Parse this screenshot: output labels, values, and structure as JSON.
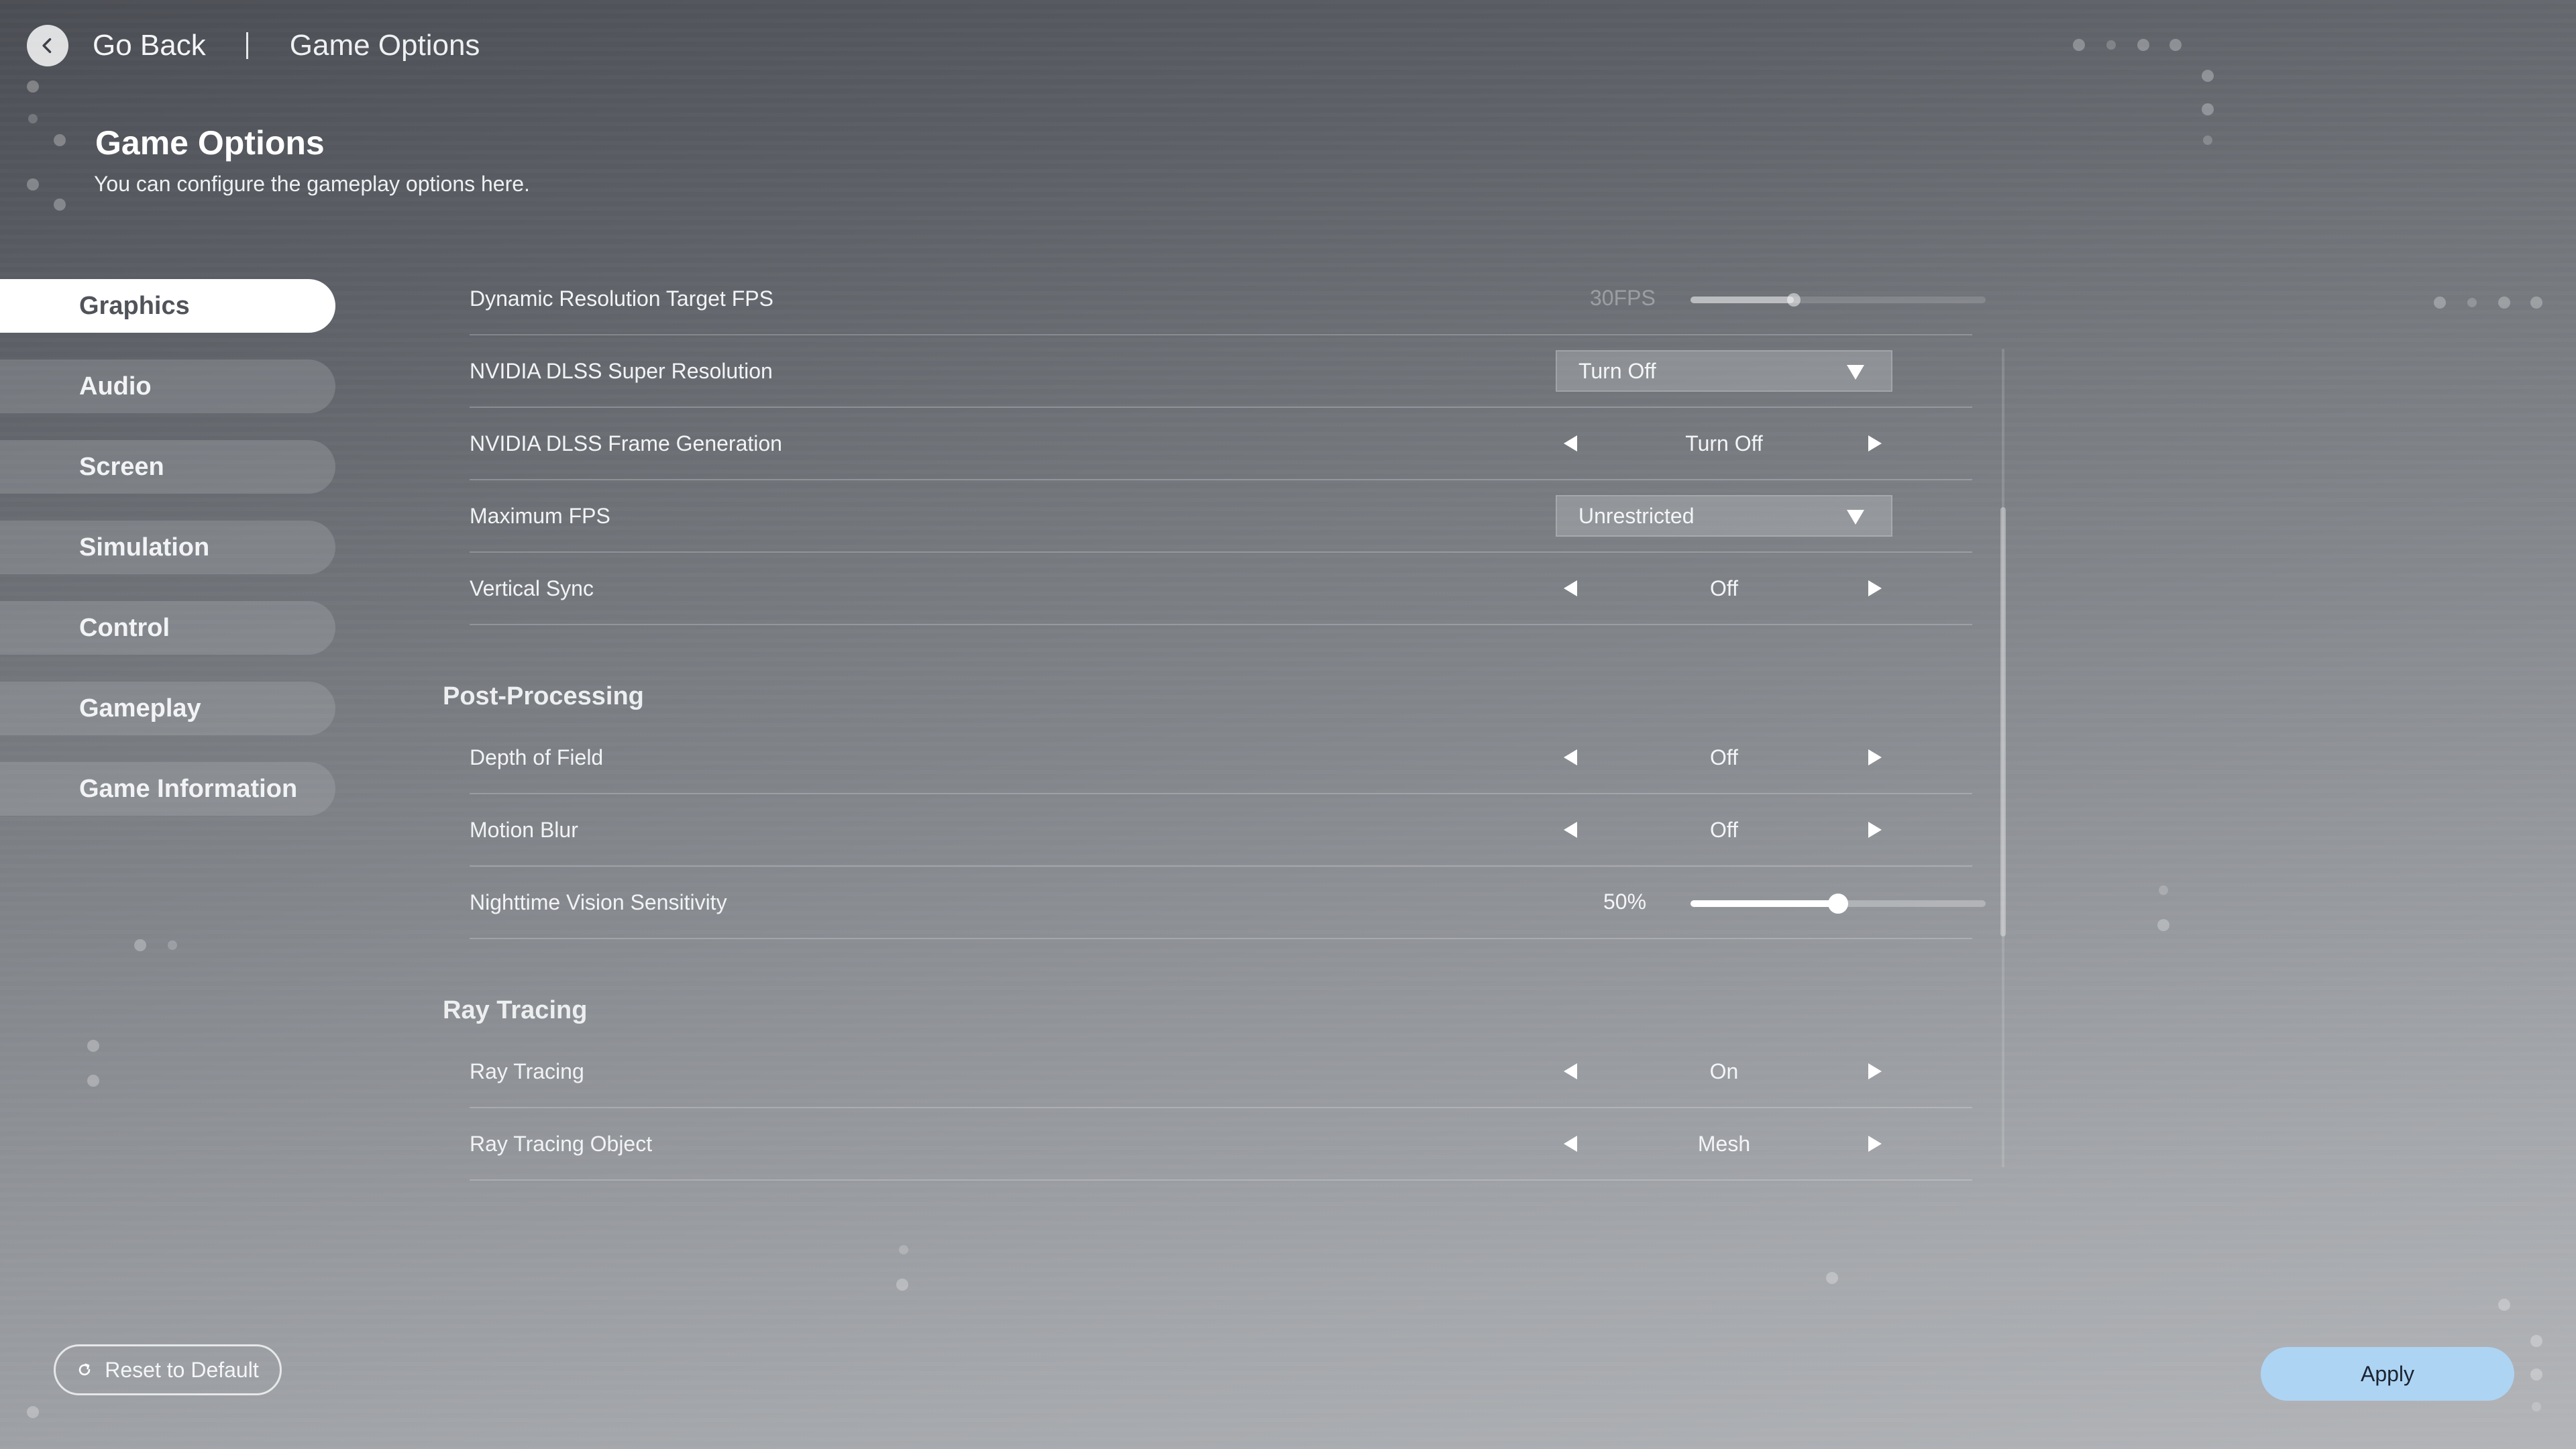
{
  "topbar": {
    "back_icon": "chevron-left-icon",
    "back_label": "Go Back",
    "title": "Game Options"
  },
  "header": {
    "title": "Game Options",
    "subtitle": "You can configure the gameplay options here."
  },
  "sidebar": {
    "items": [
      {
        "label": "Graphics",
        "active": true
      },
      {
        "label": "Audio",
        "active": false
      },
      {
        "label": "Screen",
        "active": false
      },
      {
        "label": "Simulation",
        "active": false
      },
      {
        "label": "Control",
        "active": false
      },
      {
        "label": "Gameplay",
        "active": false
      },
      {
        "label": "Game Information",
        "active": false
      }
    ]
  },
  "settings": {
    "dynamic_resolution": {
      "label": "Dynamic Resolution Target FPS",
      "value": "30FPS",
      "level": 0.35,
      "enabled": false
    },
    "dlss_sr": {
      "label": "NVIDIA DLSS Super Resolution",
      "value": "Turn Off"
    },
    "dlss_fg": {
      "label": "NVIDIA DLSS Frame Generation",
      "value": "Turn Off"
    },
    "max_fps": {
      "label": "Maximum FPS",
      "value": "Unrestricted"
    },
    "vsync": {
      "label": "Vertical Sync",
      "value": "Off"
    },
    "post_processing": {
      "title": "Post-Processing",
      "depth_of_field": {
        "label": "Depth of Field",
        "value": "Off"
      },
      "motion_blur": {
        "label": "Motion Blur",
        "value": "Off"
      },
      "night_vision": {
        "label": "Nighttime Vision Sensitivity",
        "value": "50%",
        "level": 0.5
      }
    },
    "ray_tracing": {
      "title": "Ray Tracing",
      "ray_tracing": {
        "label": "Ray Tracing",
        "value": "On"
      },
      "ray_tracing_object": {
        "label": "Ray Tracing Object",
        "value": "Mesh"
      }
    }
  },
  "footer": {
    "reset_icon": "refresh-icon",
    "reset_label": "Reset to Default",
    "apply_label": "Apply"
  },
  "colors": {
    "apply_button": "#aed4f4",
    "active_tab": "#ffffff"
  }
}
